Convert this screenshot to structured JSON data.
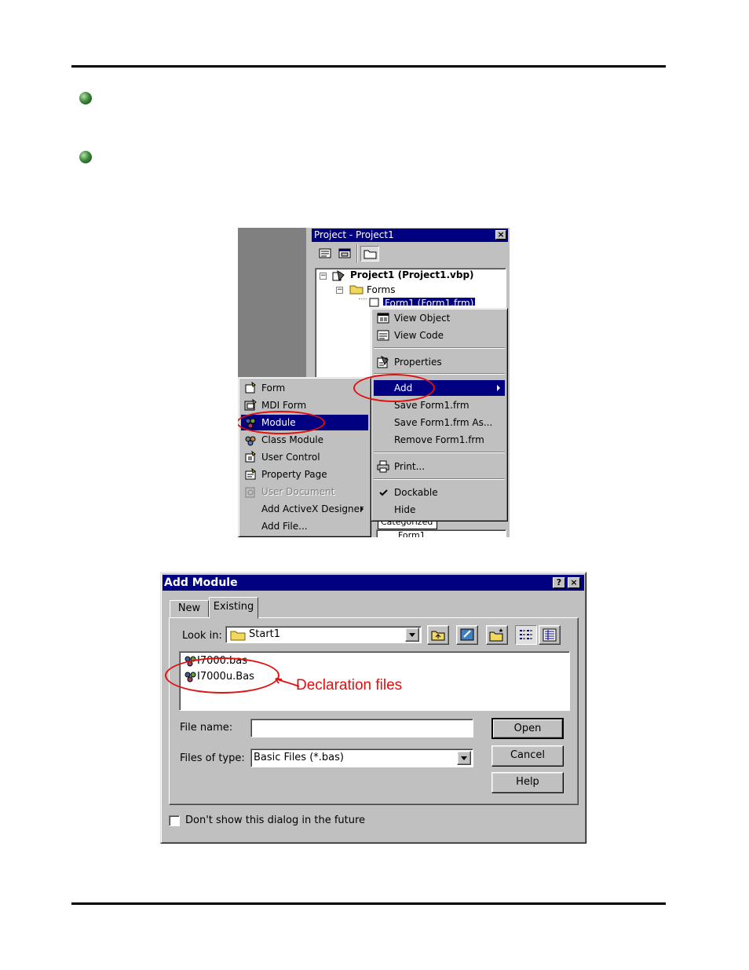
{
  "project_window": {
    "title": "Project - Project1",
    "close": "×",
    "tree": {
      "root": "Project1 (Project1.vbp)",
      "folder": "Forms",
      "form_item": "Form1 (Form1.frm)",
      "under_label": "Categorized",
      "under_value": "Form1"
    }
  },
  "context_menu": {
    "items": [
      {
        "label": "View Object",
        "icon": "view-object-icon"
      },
      {
        "label": "View Code",
        "icon": "view-code-icon"
      },
      {
        "label": "Properties",
        "icon": "properties-icon"
      },
      {
        "label": "Add",
        "icon": ""
      },
      {
        "label": "Save Form1.frm",
        "icon": ""
      },
      {
        "label": "Save Form1.frm As...",
        "icon": ""
      },
      {
        "label": "Remove Form1.frm",
        "icon": ""
      },
      {
        "label": "Print...",
        "icon": "printer-icon"
      },
      {
        "label": "Dockable",
        "icon": "check-icon"
      },
      {
        "label": "Hide",
        "icon": ""
      }
    ]
  },
  "add_submenu": {
    "items": [
      {
        "label": "Form",
        "icon": "form-icon"
      },
      {
        "label": "MDI Form",
        "icon": "mdi-form-icon"
      },
      {
        "label": "Module",
        "icon": "module-icon"
      },
      {
        "label": "Class Module",
        "icon": "class-module-icon"
      },
      {
        "label": "User Control",
        "icon": "user-control-icon"
      },
      {
        "label": "Property Page",
        "icon": "property-page-icon"
      },
      {
        "label": "User Document",
        "icon": "user-document-icon"
      },
      {
        "label": "Add ActiveX Designer",
        "icon": ""
      },
      {
        "label": "Add File...",
        "icon": ""
      }
    ]
  },
  "add_module_dialog": {
    "title": "Add Module",
    "help_btn": "?",
    "close_btn": "×",
    "tabs": [
      "New",
      "Existing"
    ],
    "look_in_label": "Look in:",
    "look_in_value": "Start1",
    "files": [
      "I7000.bas",
      "I7000u.Bas"
    ],
    "annotation": "Declaration files",
    "file_name_label": "File name:",
    "file_name_value": "",
    "files_of_type_label": "Files of type:",
    "files_of_type_value": "Basic Files (*.bas)",
    "open_btn": "Open",
    "cancel_btn": "Cancel",
    "help_button": "Help",
    "dont_show": "Don't show this dialog in the future"
  },
  "colors": {
    "title_bar": "#000080",
    "face": "#c0c0c0",
    "highlight": "#000080",
    "annotation": "#e01010"
  }
}
